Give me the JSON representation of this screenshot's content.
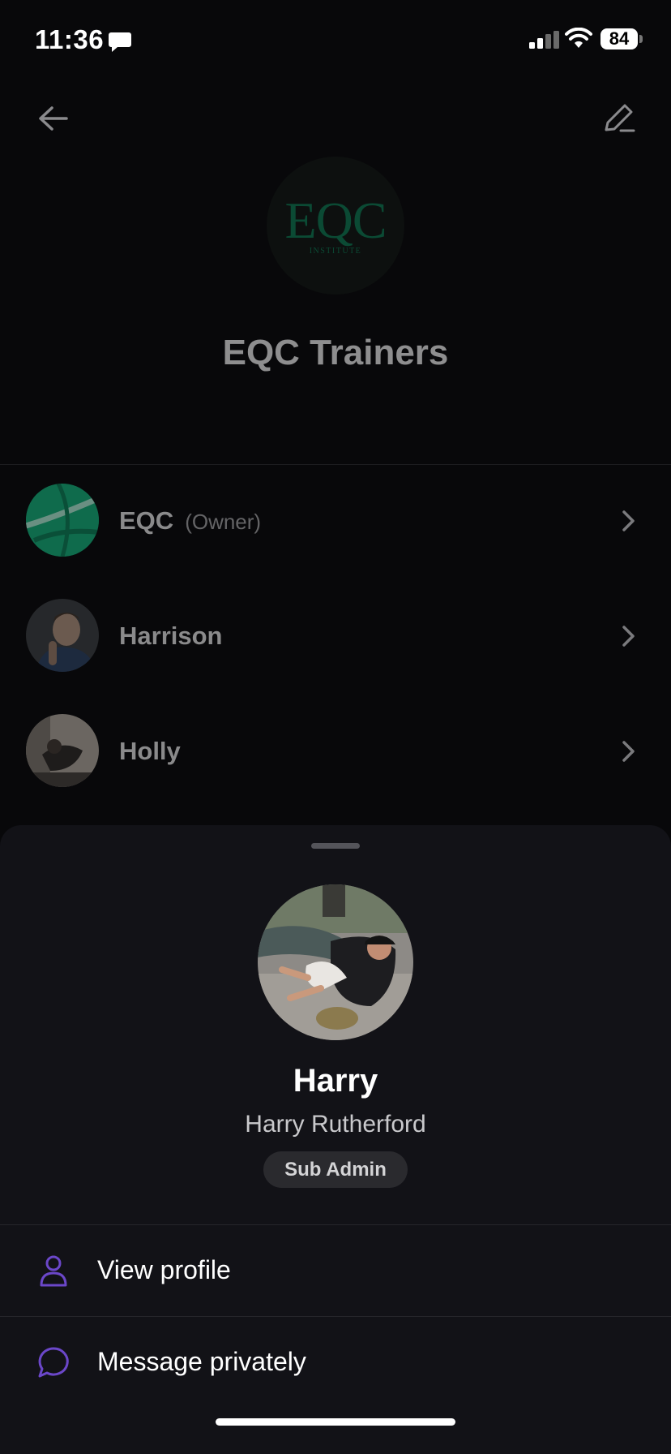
{
  "status_bar": {
    "time": "11:36",
    "battery": "84"
  },
  "group": {
    "logo_text": "EQC",
    "logo_sub": "INSTITUTE",
    "title": "EQC Trainers"
  },
  "members": [
    {
      "name": "EQC",
      "role": "(Owner)"
    },
    {
      "name": "Harrison",
      "role": ""
    },
    {
      "name": "Holly",
      "role": ""
    }
  ],
  "sheet": {
    "display_name": "Harry",
    "full_name": "Harry Rutherford",
    "role_badge": "Sub Admin",
    "actions": [
      {
        "label": "View profile",
        "icon": "person-icon"
      },
      {
        "label": "Message privately",
        "icon": "chat-bubble-icon"
      }
    ]
  },
  "colors": {
    "accent": "#6b47c9",
    "sheet_bg": "#121217",
    "logo_green": "#0b4a34"
  }
}
